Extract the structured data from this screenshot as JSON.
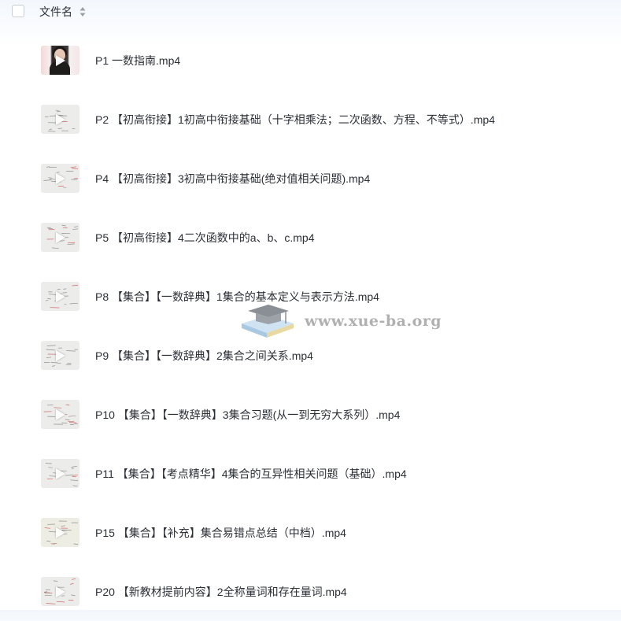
{
  "header": {
    "column_title": "文件名",
    "select_all_checked": false,
    "sort_icon": "sort-icon"
  },
  "files": [
    {
      "name": "P1 一数指南.mp4",
      "thumb": "photo"
    },
    {
      "name": "P2 【初高衔接】1初高中衔接基础（十字相乘法；二次函数、方程、不等式）.mp4",
      "thumb": "pale"
    },
    {
      "name": "P4 【初高衔接】3初高中衔接基础(绝对值相关问题).mp4",
      "thumb": "pale"
    },
    {
      "name": "P5 【初高衔接】4二次函数中的a、b、c.mp4",
      "thumb": "pale"
    },
    {
      "name": "P8 【集合】【一数辞典】1集合的基本定义与表示方法.mp4",
      "thumb": "pale"
    },
    {
      "name": "P9 【集合】【一数辞典】2集合之间关系.mp4",
      "thumb": "pale"
    },
    {
      "name": "P10 【集合】【一数辞典】3集合习题(从一到无穷大系列）.mp4",
      "thumb": "pale"
    },
    {
      "name": "P11 【集合】【考点精华】4集合的互异性相关问题（基础）.mp4",
      "thumb": "pale"
    },
    {
      "name": "P15 【集合】【补充】集合易错点总结（中档）.mp4",
      "thumb": "warm"
    },
    {
      "name": "P20 【新教材提前内容】2全称量词和存在量词.mp4",
      "thumb": "pale"
    }
  ],
  "watermark": {
    "text": "www.xue-ba.org",
    "icon": "graduation-cap-books-icon"
  },
  "colors": {
    "text": "#2b2f36",
    "checkbox_border": "#c9cdd4",
    "header_gradient_top": "#f3f7fd"
  }
}
